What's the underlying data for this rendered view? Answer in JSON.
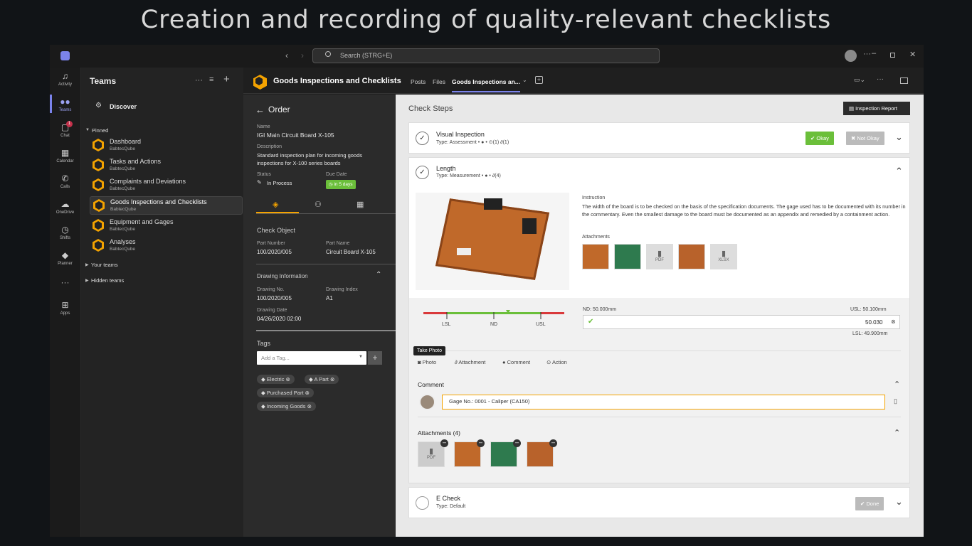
{
  "headline": "Creation and recording of quality-relevant checklists",
  "search": {
    "placeholder": "Search (STRG+E)"
  },
  "rail": [
    {
      "label": "Activity",
      "icon": "bell-icon"
    },
    {
      "label": "Teams",
      "icon": "teams-icon"
    },
    {
      "label": "Chat",
      "icon": "chat-icon",
      "badge": "1"
    },
    {
      "label": "Calendar",
      "icon": "calendar-icon"
    },
    {
      "label": "Calls",
      "icon": "phone-icon"
    },
    {
      "label": "OneDrive",
      "icon": "cloud-icon"
    },
    {
      "label": "Shifts",
      "icon": "clock-icon"
    },
    {
      "label": "Planner",
      "icon": "planner-icon"
    },
    {
      "label": "Apps",
      "icon": "plus-box-icon"
    }
  ],
  "teams_panel": {
    "title": "Teams",
    "discover": "Discover",
    "pinned": "Pinned",
    "items": [
      {
        "name": "Dashboard",
        "sub": "BabtecQube"
      },
      {
        "name": "Tasks and Actions",
        "sub": "BabtecQube"
      },
      {
        "name": "Complaints and Deviations",
        "sub": "BabtecQube"
      },
      {
        "name": "Goods Inspections and Checklists",
        "sub": "BabtecQube"
      },
      {
        "name": "Equipment and Gages",
        "sub": "BabtecQube"
      },
      {
        "name": "Analyses",
        "sub": "BabtecQube"
      }
    ],
    "your_teams": "Your teams",
    "hidden_teams": "Hidden teams"
  },
  "channel": {
    "title": "Goods Inspections and Checklists",
    "tabs": [
      "Posts",
      "Files",
      "Goods Inspections an..."
    ]
  },
  "order": {
    "title": "Order",
    "name_label": "Name",
    "name": "IGI Main Circuit Board X-105",
    "desc_label": "Description",
    "desc": "Standard inspection plan for incoming goods inspections for X-100 series boards",
    "status_label": "Status",
    "status": "In Process",
    "due_label": "Due Date",
    "due": "in 5 days",
    "check_object": "Check Object",
    "part_number_label": "Part Number",
    "part_number": "100/2020/005",
    "part_name_label": "Part Name",
    "part_name": "Circuit Board X-105",
    "drawing_info": "Drawing Information",
    "drawing_no_label": "Drawing No.",
    "drawing_no": "100/2020/005",
    "drawing_index_label": "Drawing Index",
    "drawing_index": "A1",
    "drawing_date_label": "Drawing Date",
    "drawing_date": "04/26/2020 02:00",
    "tags_title": "Tags",
    "tag_placeholder": "Add a Tag...",
    "tags": [
      "Electric",
      "A Part",
      "Purchased Part",
      "Incoming Goods"
    ]
  },
  "steps": {
    "title": "Check Steps",
    "report_button": "Inspection Report",
    "visual": {
      "name": "Visual Inspection",
      "type": "Type: Assessment",
      "counts": "(1)",
      "att": "(1)",
      "okay": "Okay",
      "not_okay": "Not Okay"
    },
    "length": {
      "name": "Length",
      "type": "Type: Measurement",
      "att": "(4)",
      "instruction_label": "Instruction",
      "instruction": "The width of the board is to be checked on the basis of the specification documents. The gage used has to be documented with its number in the commentary. Even the smallest damage to the board must be documented as an appendix and remedied by a containment action.",
      "attachments_label": "Attachments",
      "doc1": "PDF",
      "doc2": "XLSX",
      "nd": "ND: 50.000mm",
      "usl": "USL: 50.100mm",
      "lsl": "LSL: 49.900mm",
      "value": "50.030",
      "scale_lsl": "LSL",
      "scale_nd": "ND",
      "scale_usl": "USL",
      "tooltip": "Take Photo",
      "actions": [
        "Photo",
        "Attachment",
        "Comment",
        "Action"
      ],
      "comment_label": "Comment",
      "comment": "Gage No.: 0001 - Caliper (CA150)",
      "attachments4": "Attachments (4)",
      "att_doc": "PDF"
    },
    "echeck": {
      "name": "E Check",
      "type": "Type: Default",
      "done": "Done"
    }
  },
  "colors": {
    "accent": "#f4a300",
    "ok": "#6bbf3a",
    "teams_purple": "#7b83eb"
  }
}
